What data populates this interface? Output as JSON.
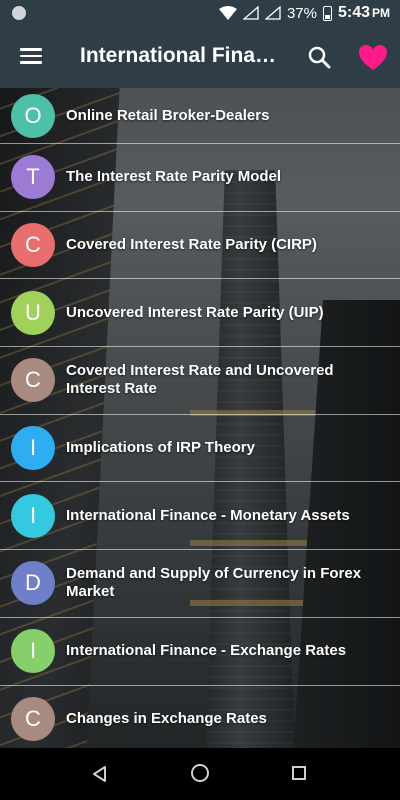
{
  "status_bar": {
    "battery": "37%",
    "time": "5:43",
    "ampm": "PM",
    "icons": [
      "notification-dot-icon",
      "wifi-icon",
      "signal-icon",
      "signal-icon",
      "battery-icon"
    ]
  },
  "toolbar": {
    "title": "International Finance",
    "menu_icon": "hamburger-menu-icon",
    "search_icon": "search-icon",
    "favorite_icon": "heart-icon",
    "background": "#2f3e46",
    "favorite_color": "#ff1a8c"
  },
  "items": [
    {
      "letter": "O",
      "label": "Online Retail Broker-Dealers",
      "color": "#4cc1a8"
    },
    {
      "letter": "T",
      "label": "The Interest Rate Parity Model",
      "color": "#9b7bd4"
    },
    {
      "letter": "C",
      "label": "Covered Interest Rate Parity (CIRP)",
      "color": "#e86e6e"
    },
    {
      "letter": "U",
      "label": "Uncovered Interest Rate Parity (UIP)",
      "color": "#9fd15b"
    },
    {
      "letter": "C",
      "label": "Covered Interest Rate and Uncovered Interest Rate",
      "color": "#a88a7e"
    },
    {
      "letter": "I",
      "label": "Implications of IRP Theory",
      "color": "#2eaef0"
    },
    {
      "letter": "I",
      "label": "International Finance - Monetary Assets",
      "color": "#33c9e0"
    },
    {
      "letter": "D",
      "label": "Demand and Supply of Currency in Forex Market",
      "color": "#6f7fc9"
    },
    {
      "letter": "I",
      "label": "International Finance - Exchange Rates",
      "color": "#86cf6a"
    },
    {
      "letter": "C",
      "label": "Changes in Exchange Rates",
      "color": "#a88a7e"
    }
  ],
  "nav_bar": {
    "back_icon": "back-triangle-icon",
    "home_icon": "home-circle-icon",
    "recents_icon": "recents-square-icon"
  }
}
